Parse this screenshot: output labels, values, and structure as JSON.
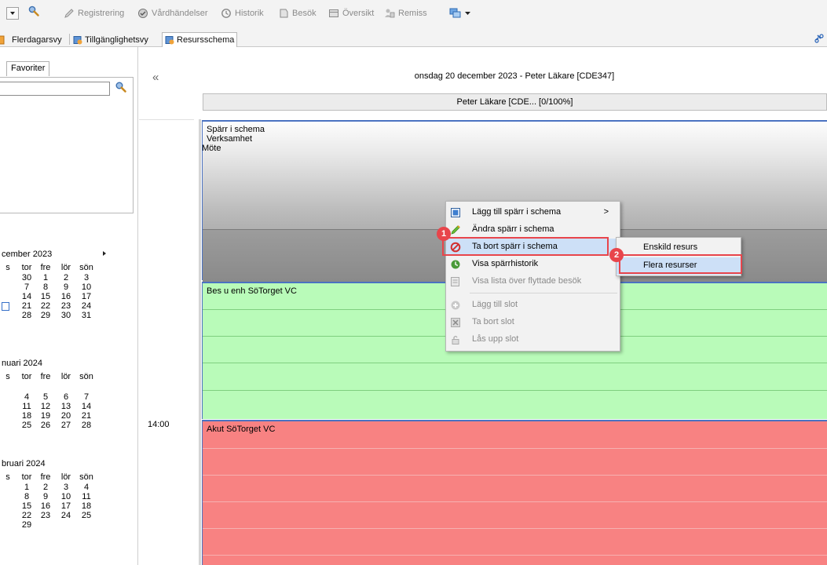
{
  "toolbar": {
    "items": [
      {
        "label": "Registrering",
        "icon": "pen-icon"
      },
      {
        "label": "Vårdhändelser",
        "icon": "care-event-icon"
      },
      {
        "label": "Historik",
        "icon": "history-icon"
      },
      {
        "label": "Besök",
        "icon": "visit-icon"
      },
      {
        "label": "Översikt",
        "icon": "overview-icon"
      },
      {
        "label": "Remiss",
        "icon": "referral-icon"
      }
    ]
  },
  "view_tabs": [
    "Flerdagarsvy",
    "Tillgänglighetsvy",
    "Resursschema"
  ],
  "left_panel": {
    "favorites_tab": "Favoriter",
    "search_value": "",
    "calendars": [
      {
        "title": "cember 2023",
        "headers": [
          "s",
          "tor",
          "fre",
          "lör",
          "sön"
        ],
        "rows": [
          [
            "",
            "30",
            "1",
            "2",
            "3"
          ],
          [
            "",
            "7",
            "8",
            "9",
            "10"
          ],
          [
            "",
            "14",
            "15",
            "16",
            "17"
          ],
          [
            "",
            "21",
            "22",
            "23",
            "24"
          ],
          [
            "",
            "28",
            "29",
            "30",
            "31"
          ]
        ]
      },
      {
        "title": "nuari 2024",
        "headers": [
          "s",
          "tor",
          "fre",
          "lör",
          "sön"
        ],
        "rows": [
          [
            "",
            "",
            "",
            "",
            ""
          ],
          [
            "",
            "4",
            "5",
            "6",
            "7"
          ],
          [
            "",
            "11",
            "12",
            "13",
            "14"
          ],
          [
            "",
            "18",
            "19",
            "20",
            "21"
          ],
          [
            "",
            "25",
            "26",
            "27",
            "28"
          ]
        ]
      },
      {
        "title": "bruari 2024",
        "headers": [
          "s",
          "tor",
          "fre",
          "lör",
          "sön"
        ],
        "rows": [
          [
            "",
            "1",
            "2",
            "3",
            "4"
          ],
          [
            "",
            "8",
            "9",
            "10",
            "11"
          ],
          [
            "",
            "15",
            "16",
            "17",
            "18"
          ],
          [
            "",
            "22",
            "23",
            "24",
            "25"
          ],
          [
            "",
            "29",
            "",
            "",
            ""
          ]
        ]
      }
    ]
  },
  "schedule": {
    "collapse_symbol": "«",
    "date_header": "onsdag 20 december 2023 - Peter Läkare [CDE347]",
    "resource_header": "Peter Läkare [CDE... [0/100%]",
    "time_label": "14:00",
    "blocks": {
      "grey": {
        "line1": "Spärr i schema",
        "line2": "Verksamhet",
        "line3": "Möte"
      },
      "green": {
        "title": "Bes u enh SöTorget VC"
      },
      "red": {
        "title": "Akut SöTorget VC"
      }
    }
  },
  "context_menu": {
    "items": [
      {
        "label": "Lägg till spärr i schema",
        "submenu_arrow": ">",
        "icon": "add-block-icon",
        "enabled": true
      },
      {
        "label": "Ändra spärr i schema",
        "icon": "edit-icon",
        "enabled": true
      },
      {
        "label": "Ta bort spärr i schema",
        "icon": "remove-block-icon",
        "enabled": true
      },
      {
        "label": "Visa spärrhistorik",
        "icon": "history-icon",
        "enabled": true
      },
      {
        "label": "Visa lista över flyttade besök",
        "icon": "list-icon",
        "enabled": false
      },
      {
        "label": "Lägg till slot",
        "icon": "add-slot-icon",
        "enabled": false
      },
      {
        "label": "Ta bort slot",
        "icon": "remove-slot-icon",
        "enabled": false
      },
      {
        "label": "Lås upp slot",
        "icon": "unlock-icon",
        "enabled": false
      }
    ],
    "submenu": [
      "Enskild resurs",
      "Flera resurser"
    ]
  },
  "callouts": [
    "1",
    "2"
  ],
  "colors": {
    "grey_block_top": "#fdfdfd",
    "grey_block_bottom": "#8f8f8f",
    "green_block": "#b9fbb9",
    "red_block": "#f88282",
    "block_border": "#4b72c1",
    "highlight": "#cde0f7",
    "callout": "#e8454b"
  }
}
